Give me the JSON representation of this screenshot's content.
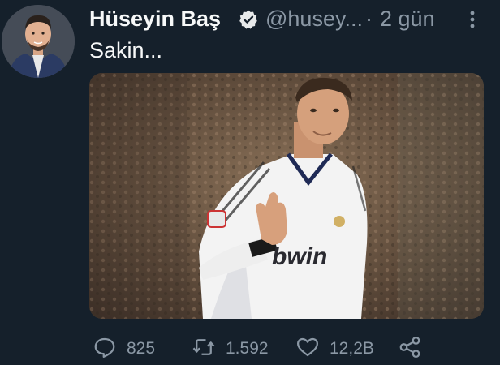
{
  "tweet": {
    "author_name": "Hüseyin Baş",
    "handle": "@husey...",
    "separator": "·",
    "time": "2 gün",
    "text": "Sakin...",
    "media_jersey_text": "bwin"
  },
  "actions": {
    "replies": "825",
    "retweets": "1.592",
    "likes": "12,2B"
  },
  "icons": {
    "verified": "verified-badge-icon",
    "more": "more-vertical-icon",
    "reply": "reply-icon",
    "retweet": "retweet-icon",
    "like": "heart-icon",
    "share": "share-icon"
  },
  "colors": {
    "background": "#15202b",
    "primary_text": "#f7f9f9",
    "secondary_text": "#8b98a5"
  }
}
